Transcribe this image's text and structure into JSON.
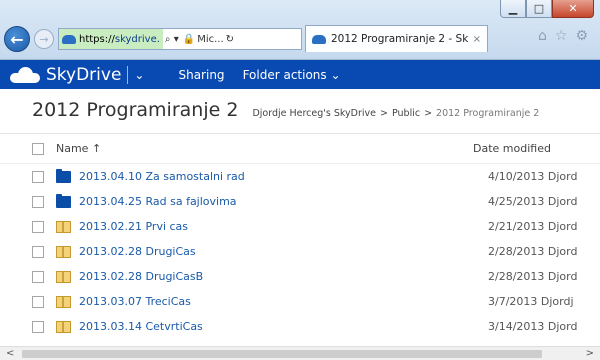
{
  "browser": {
    "address": {
      "url_prefix": "https://",
      "url_host": "skydrive.",
      "search_glyph": "⌕ ▾",
      "secure_site": "Mic...",
      "refresh_glyph": "↻"
    },
    "tab": {
      "title": "2012 Programiranje 2 - Sk...",
      "close": "×"
    },
    "back_glyph": "←",
    "forward_glyph": "→",
    "window_controls": {
      "min": "▁",
      "max": "□",
      "close": "✕"
    },
    "tools": {
      "home": "⌂",
      "favorites": "☆",
      "settings": "⚙"
    }
  },
  "app": {
    "brand": "SkyDrive",
    "brand_menu_glyph": "⌄",
    "nav": {
      "sharing": "Sharing",
      "folder_actions": "Folder actions ⌄"
    }
  },
  "folder": {
    "title": "2012 Programiranje 2",
    "breadcrumb": [
      "Djordje Herceg's SkyDrive",
      "Public",
      "2012 Programiranje 2"
    ],
    "crumb_sep": ">"
  },
  "columns": {
    "name": "Name ↑",
    "date": "Date modified"
  },
  "files": [
    {
      "name": "2013.04.10 Za samostalni rad",
      "date": "4/10/2013 Djord",
      "kind": "folder"
    },
    {
      "name": "2013.04.25 Rad sa fajlovima",
      "date": "4/25/2013 Djord",
      "kind": "folder"
    },
    {
      "name": "2013.02.21 Prvi cas",
      "date": "2/21/2013 Djord",
      "kind": "zip"
    },
    {
      "name": "2013.02.28 DrugiCas",
      "date": "2/28/2013 Djord",
      "kind": "zip"
    },
    {
      "name": "2013.02.28 DrugiCasB",
      "date": "2/28/2013 Djord",
      "kind": "zip"
    },
    {
      "name": "2013.03.07 TreciCas",
      "date": "3/7/2013 Djordj",
      "kind": "zip"
    },
    {
      "name": "2013.03.14 CetvrtiCas",
      "date": "3/14/2013 Djord",
      "kind": "zip"
    }
  ],
  "scrollbar": {
    "left": "<",
    "right": ">"
  },
  "colors": {
    "brand_bar": "#094ab2",
    "link": "#1a5aa8",
    "chrome": "#c9ddf0"
  }
}
